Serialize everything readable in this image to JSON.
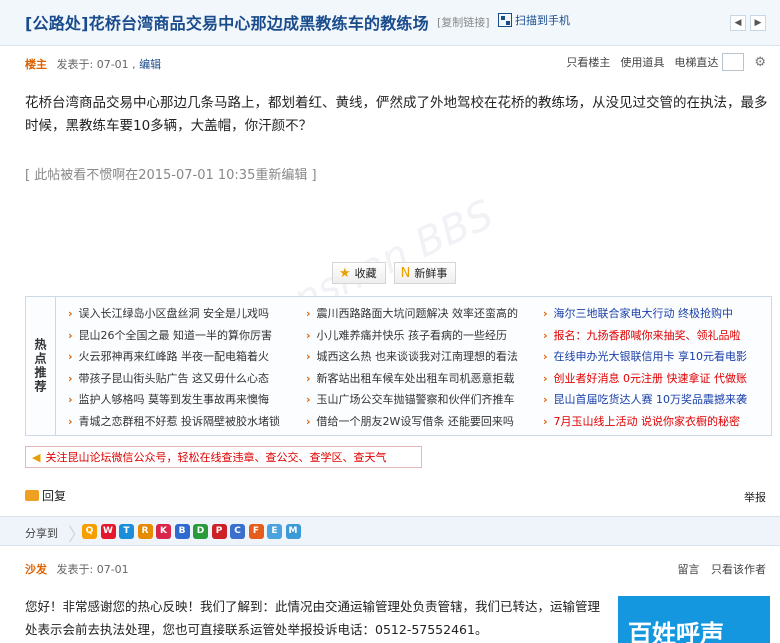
{
  "thread": {
    "title": "[公路处]花桥台湾商品交易中心那边成黑教练车的教练场",
    "copy_link": "[复制链接]",
    "scan_to_phone": "扫描到手机",
    "prev_icon": "left-arrow",
    "next_icon": "right-arrow"
  },
  "post": {
    "author": "楼主",
    "posted_at": "发表于: 07-01",
    "edit_link": "编辑",
    "tools": {
      "only_author": "只看楼主",
      "use_props": "使用道具",
      "jump": "电梯直达"
    },
    "content": "花桥台湾商品交易中心那边几条马路上，都划着红、黄线，俨然成了外地驾校在花桥的教练场，从没见过交管的在执法，最多时候，黑教练车要10多辆，大盖帽，你汗颜不？",
    "edited_note": "[ 此帖被看不惯啊在2015-07-01 10:35重新编辑 ]",
    "favorite_label": "收藏",
    "fresh_label": "新鲜事"
  },
  "hot": {
    "label": "热点推荐",
    "col1": [
      "误入长江绿岛小区盘丝洞 安全是儿戏吗",
      "昆山26个全国之最 知道一半的算你厉害",
      "火云邪神再来红峰路 半夜一配电箱着火",
      "带孩子昆山街头贴广告 这又毋什么心态",
      "监护人够格吗 莫等到发生事故再来懊悔",
      "青城之恋群租不好惹 投诉隔壁被胶水堵锁"
    ],
    "col2": [
      "震川西路路面大坑问题解决 效率还蛮高的",
      "小儿难养痛并快乐 孩子看病的一些经历",
      "城西这么热 也来谈谈我对江南理想的看法",
      "新客站出租车候车处出租车司机恶意拒载",
      "玉山广场公交车抛锚警察和伙伴们齐推车",
      "借给一个朋友2W设写借条 还能要回来吗"
    ],
    "col3": [
      {
        "text": "海尔三地联合家电大行动 终极抢购中",
        "red": false
      },
      {
        "text": "报名：九扬香郡喊你来抽奖、领礼品啦",
        "red": true
      },
      {
        "text": "在线申办光大银联信用卡 享10元看电影",
        "red": false
      },
      {
        "text": "创业者好消息 0元注册 快速拿证 代做账",
        "red": true
      },
      {
        "text": "昆山首届吃货达人赛 10万奖品震撼来袭",
        "red": false
      },
      {
        "text": "7月玉山线上活动 说说你家衣橱的秘密",
        "red": true
      }
    ]
  },
  "notice": {
    "text": "关注昆山论坛微信公众号，轻松在线查违章、查公交、查学区、查天气"
  },
  "reply_bar": {
    "reply": "回复",
    "report": "举报"
  },
  "share": {
    "label": "分享到",
    "icons": [
      {
        "name": "qzone",
        "color": "#f5a000",
        "glyph": "Q"
      },
      {
        "name": "weibo",
        "color": "#e6162d",
        "glyph": "W"
      },
      {
        "name": "qq-weibo",
        "color": "#1c8dd8",
        "glyph": "T"
      },
      {
        "name": "renren",
        "color": "#e68a00",
        "glyph": "R"
      },
      {
        "name": "kaixin",
        "color": "#d9254a",
        "glyph": "K"
      },
      {
        "name": "baidu",
        "color": "#2e6bd1",
        "glyph": "B"
      },
      {
        "name": "douban",
        "color": "#2a9b3a",
        "glyph": "D"
      },
      {
        "name": "pinterest",
        "color": "#cc2127",
        "glyph": "P"
      },
      {
        "name": "baidu-cang",
        "color": "#3a6fcc",
        "glyph": "C"
      },
      {
        "name": "fire",
        "color": "#e65c1a",
        "glyph": "F"
      },
      {
        "name": "feed",
        "color": "#4aa3df",
        "glyph": "E"
      },
      {
        "name": "bookmark",
        "color": "#3c9bd6",
        "glyph": "M"
      }
    ]
  },
  "reply_post": {
    "author": "沙发",
    "posted_at": "发表于: 07-01",
    "tools": {
      "message": "留言",
      "only_this": "只看该作者"
    },
    "content": "您好！非常感谢您的热心反映！我们了解到：此情况由交通运输管理处负责管辖，我们已转达，运输管理处表示会前去执法处理，您也可直接联系运管处举报投诉电话：0512-57552461。",
    "ad_text": "百姓呼声"
  }
}
